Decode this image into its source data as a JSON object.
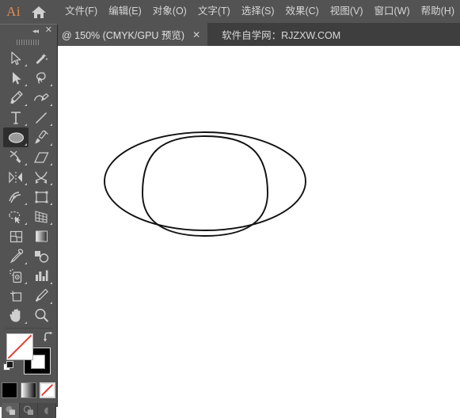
{
  "app": {
    "logo_text": "Ai",
    "home_icon": "home-icon"
  },
  "menubar": {
    "items": [
      {
        "label": "文件(F)",
        "name": "menu-file"
      },
      {
        "label": "编辑(E)",
        "name": "menu-edit"
      },
      {
        "label": "对象(O)",
        "name": "menu-object"
      },
      {
        "label": "文字(T)",
        "name": "menu-type"
      },
      {
        "label": "选择(S)",
        "name": "menu-select"
      },
      {
        "label": "效果(C)",
        "name": "menu-effect"
      },
      {
        "label": "视图(V)",
        "name": "menu-view"
      },
      {
        "label": "窗口(W)",
        "name": "menu-window"
      },
      {
        "label": "帮助(H)",
        "name": "menu-help"
      }
    ]
  },
  "tabbar": {
    "active_tab": {
      "label": "@ 150% (CMYK/GPU 预览)",
      "close_glyph": "✕"
    },
    "secondary_tab": {
      "label": "软件自学网：RJZXW.COM"
    }
  },
  "toolpanel": {
    "collapse_glyph": "◂◂",
    "close_glyph": "✕",
    "tools": [
      {
        "name": "selection-tool",
        "label": "选择工具",
        "has_corner": true,
        "selected": false
      },
      {
        "name": "magic-wand-tool",
        "label": "魔棒工具",
        "has_corner": false,
        "selected": false
      },
      {
        "name": "direct-selection-tool",
        "label": "直接选择工具",
        "has_corner": true,
        "selected": false
      },
      {
        "name": "lasso-tool",
        "label": "套索工具",
        "has_corner": true,
        "selected": false
      },
      {
        "name": "pen-tool",
        "label": "钢笔工具",
        "has_corner": true,
        "selected": false
      },
      {
        "name": "curvature-tool",
        "label": "曲率工具",
        "has_corner": true,
        "selected": false
      },
      {
        "name": "type-tool",
        "label": "文字工具",
        "has_corner": true,
        "selected": false
      },
      {
        "name": "line-segment-tool",
        "label": "直线段工具",
        "has_corner": true,
        "selected": false
      },
      {
        "name": "ellipse-tool",
        "label": "椭圆工具",
        "has_corner": true,
        "selected": true
      },
      {
        "name": "paintbrush-tool",
        "label": "画笔工具",
        "has_corner": true,
        "selected": false
      },
      {
        "name": "shaper-tool",
        "label": "Shaper 工具",
        "has_corner": true,
        "selected": false
      },
      {
        "name": "eraser-tool",
        "label": "橡皮擦工具",
        "has_corner": true,
        "selected": false
      },
      {
        "name": "rotate-tool",
        "label": "旋转工具",
        "has_corner": true,
        "selected": false
      },
      {
        "name": "scale-tool",
        "label": "比例缩放工具",
        "has_corner": true,
        "selected": false
      },
      {
        "name": "width-tool",
        "label": "宽度工具",
        "has_corner": true,
        "selected": false
      },
      {
        "name": "free-transform-tool",
        "label": "自由变换工具",
        "has_corner": true,
        "selected": false
      },
      {
        "name": "shape-builder-tool",
        "label": "形状生成器工具",
        "has_corner": true,
        "selected": false
      },
      {
        "name": "perspective-grid-tool",
        "label": "透视网格工具",
        "has_corner": true,
        "selected": false
      },
      {
        "name": "mesh-tool",
        "label": "网格工具",
        "has_corner": false,
        "selected": false
      },
      {
        "name": "gradient-tool",
        "label": "渐变工具",
        "has_corner": false,
        "selected": false
      },
      {
        "name": "eyedropper-tool",
        "label": "吸管工具",
        "has_corner": true,
        "selected": false
      },
      {
        "name": "blend-tool",
        "label": "混合工具",
        "has_corner": false,
        "selected": false
      },
      {
        "name": "symbol-sprayer-tool",
        "label": "符号喷枪工具",
        "has_corner": true,
        "selected": false
      },
      {
        "name": "column-graph-tool",
        "label": "柱形图工具",
        "has_corner": true,
        "selected": false
      },
      {
        "name": "artboard-tool",
        "label": "画板工具",
        "has_corner": false,
        "selected": false
      },
      {
        "name": "slice-tool",
        "label": "切片工具",
        "has_corner": true,
        "selected": false
      },
      {
        "name": "hand-tool",
        "label": "抓手工具",
        "has_corner": true,
        "selected": false
      },
      {
        "name": "zoom-tool",
        "label": "缩放工具",
        "has_corner": false,
        "selected": false
      }
    ],
    "fill_stroke": {
      "fill_label": "填色",
      "fill_color": "none",
      "stroke_label": "描边",
      "stroke_color": "#000000",
      "swap_label": "互换填色和描边",
      "default_label": "默认填色和描边"
    },
    "color_modes": [
      {
        "name": "color-mode-solid",
        "label": "颜色",
        "selected": false
      },
      {
        "name": "color-mode-gradient",
        "label": "渐变",
        "selected": false
      },
      {
        "name": "color-mode-none",
        "label": "无",
        "selected": true
      }
    ],
    "draw_modes": [
      {
        "name": "draw-mode-normal",
        "label": "正常绘图",
        "active": true
      },
      {
        "name": "draw-mode-behind",
        "label": "背面绘图",
        "active": false
      },
      {
        "name": "draw-mode-inside",
        "label": "内部绘图",
        "active": false
      }
    ]
  },
  "canvas": {
    "artwork_name": "hat-drawing",
    "description": "帽子线稿：椭圆帽檐与圆顶帽冠",
    "stroke_color": "#111111",
    "fill_color": "none"
  }
}
